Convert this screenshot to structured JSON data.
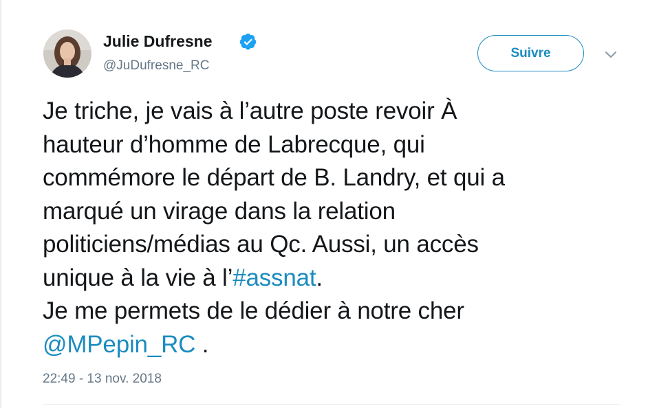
{
  "author": {
    "display_name": "Julie Dufresne",
    "handle": "@JuDufresne_RC",
    "verified": true
  },
  "actions": {
    "follow_label": "Suivre",
    "caret_icon": "chevron-down-icon"
  },
  "tweet": {
    "lines": [
      {
        "text": "Je triche, je vais à l’autre poste revoir À"
      },
      {
        "text": "hauteur d’homme de Labrecque, qui"
      },
      {
        "text": "commémore le départ de B. Landry, et qui a"
      },
      {
        "text": "marqué un virage dans la relation"
      },
      {
        "text": "politiciens/médias au Qc. Aussi, un accès"
      },
      {
        "text": "unique à la vie à l’",
        "hashtag": "#assnat",
        "after": "."
      },
      {
        "text": "Je me permets de le dédier à notre cher"
      },
      {
        "mention": "@MPepin_RC",
        "after": " ."
      }
    ]
  },
  "timestamp": "22:49 - 13 nov. 2018",
  "colors": {
    "link": "#1b8cbf",
    "text": "#14171a",
    "muted": "#657786",
    "verified": "#1da1f2"
  }
}
